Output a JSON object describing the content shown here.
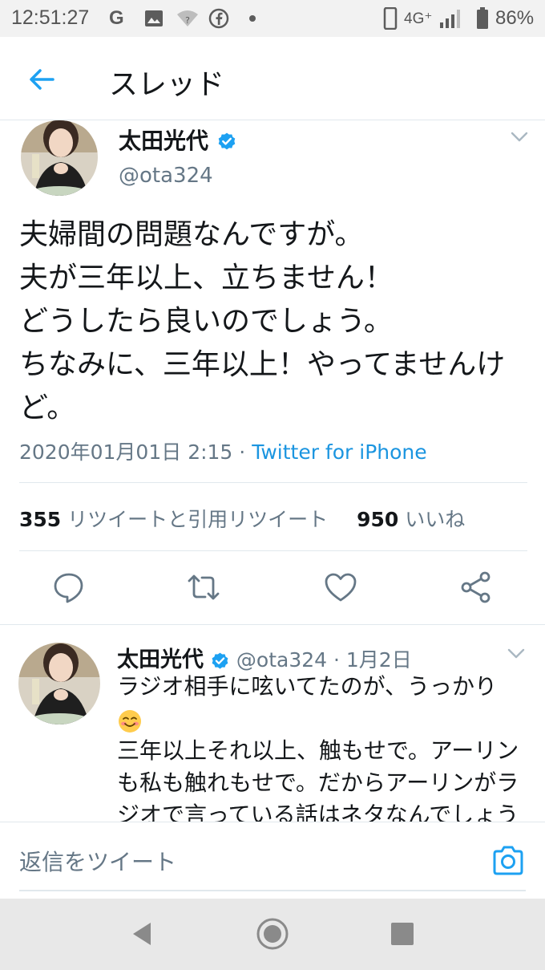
{
  "status_bar": {
    "time": "12:51:27",
    "network": "4G⁺",
    "battery": "86%",
    "icons": [
      "google-icon",
      "image-icon",
      "wifi-question-icon",
      "facebook-icon",
      "dot-icon",
      "phone-icon",
      "signal-icon",
      "battery-icon"
    ]
  },
  "app_bar": {
    "title": "スレッド",
    "back_icon": "arrow-left-icon"
  },
  "main_tweet": {
    "display_name": "太田光代",
    "handle": "@ota324",
    "text": "夫婦間の問題なんですが。\n夫が三年以上、立ちません！\nどうしたら良いのでしょう。\nちなみに、三年以上！やってませんけど。",
    "date": "2020年01月01日 2:15",
    "separator": " · ",
    "via": "Twitter for iPhone",
    "retweets_count": "355",
    "retweets_label": "リツイートと引用リツイート",
    "likes_count": "950",
    "likes_label": "いいね"
  },
  "reply_tweet": {
    "display_name": "太田光代",
    "handle": "@ota324",
    "separator": " · ",
    "date": "1月2日",
    "text_line1": "ラジオ相手に呟いてたのが、うっかり",
    "text_rest": "三年以上それ以上、触もせで。アーリンも私も触れもせで。だからアーリンがラジオで言っている話はネタなんでしょう"
  },
  "compose": {
    "placeholder": "返信をツイート"
  },
  "colors": {
    "accent": "#1da1f2",
    "link": "#1b95e0",
    "secondary_text": "#657786",
    "divider": "#e1e8ed"
  }
}
